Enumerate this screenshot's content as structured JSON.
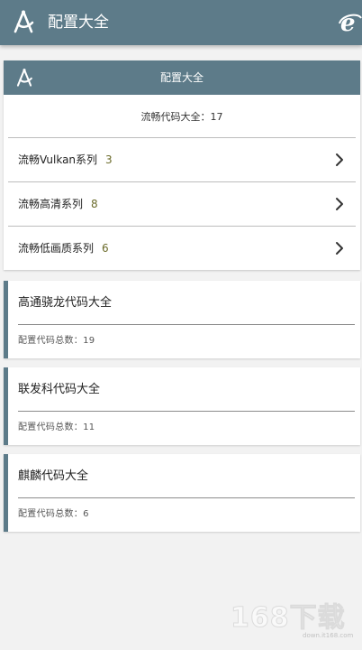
{
  "appbar": {
    "title": "配置大全",
    "logo_icon": "compass-icon",
    "right_icon": "ie-browser-icon"
  },
  "summary_card": {
    "header_title": "配置大全",
    "total_text": "流畅代码大全：17",
    "series": [
      {
        "label": "流畅Vulkan系列",
        "count": "3"
      },
      {
        "label": "流畅高清系列",
        "count": "8"
      },
      {
        "label": "流畅低画质系列",
        "count": "6"
      }
    ]
  },
  "chip_cards": [
    {
      "title": "高通骁龙代码大全",
      "count_text": "配置代码总数：19"
    },
    {
      "title": "联发科代码大全",
      "count_text": "配置代码总数：11"
    },
    {
      "title": "麒麟代码大全",
      "count_text": "配置代码总数：6"
    }
  ],
  "watermark": {
    "brand": "168下载",
    "url": "down.it168.com"
  },
  "colors": {
    "primary": "#5d7b89",
    "background": "#f2f2f2",
    "count_accent": "#6b6b2a"
  }
}
